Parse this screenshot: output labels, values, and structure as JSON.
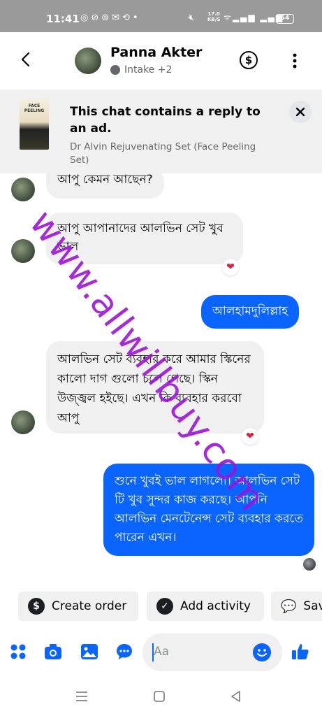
{
  "status_bar": {
    "time": "11:41",
    "network_speed": "17.0",
    "network_speed_unit": "KB/S",
    "battery": "54"
  },
  "header": {
    "name": "Panna Akter",
    "subtitle": "Intake +2"
  },
  "ad_banner": {
    "title": "This chat contains a reply to an ad.",
    "subtitle": "Dr Alvin Rejuvenating Set (Face Peeling Set)",
    "thumb_label": "FACE PEELING"
  },
  "messages": [
    {
      "direction": "in",
      "text": "আপু কেমন আছেন?"
    },
    {
      "direction": "in",
      "text": "আপু আপানাদের আলভিন সেট খুব ভাল",
      "reaction": "heart"
    },
    {
      "direction": "out",
      "text": "আলহামদুলিল্লাহ"
    },
    {
      "direction": "in",
      "text": "আলভিন সেট ব্যবহার করে আমার স্কিনের কালো দাগ গুলো চলে গেছে। স্কিন উজ্জ্বল হইছে। এখন কি ব্যবহার করবো আপু",
      "reaction": "heart"
    },
    {
      "direction": "out",
      "text": "শুনে খুবই ভাল লাগলো। আলভিন সেট টি খুব সুন্দর কাজ করছে। আপনি আলভিন মেনটেনেন্স সেট ব্যবহার করতে পারেন এখন।"
    }
  ],
  "chips": {
    "create_order": "Create order",
    "add_activity": "Add activity",
    "save": "Sav"
  },
  "composer": {
    "placeholder": "Aa"
  },
  "watermark": "www.allwillbuy.com",
  "colors": {
    "accent": "#0a64ff",
    "incoming_bubble": "#f0f0f0",
    "watermark": "#9b14d9",
    "heart": "#e41e3f"
  }
}
